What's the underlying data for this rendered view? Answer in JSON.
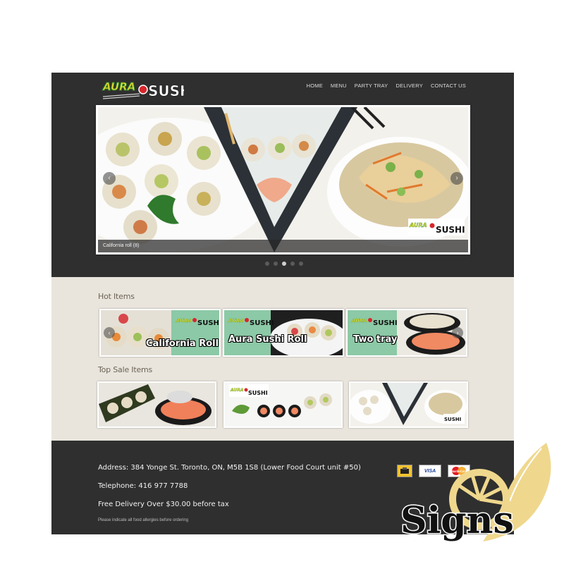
{
  "brand": {
    "logo_word_1": "AURA",
    "logo_word_2": "SUSHI"
  },
  "nav": {
    "items": [
      {
        "label": "HOME"
      },
      {
        "label": "MENU"
      },
      {
        "label": "PARTY TRAY"
      },
      {
        "label": "DELIVERY"
      },
      {
        "label": "CONTACT US"
      }
    ]
  },
  "slider": {
    "caption": "California roll (8)",
    "prev_icon": "chevron-left-icon",
    "next_icon": "chevron-right-icon",
    "slide_count": 5,
    "active_slide": 3
  },
  "hot_items": {
    "title": "Hot Items",
    "tiles": [
      {
        "label": "California Roll"
      },
      {
        "label": "Aura Sushi Roll"
      },
      {
        "label": "Two tray"
      }
    ]
  },
  "top_sale": {
    "title": "Top Sale Items"
  },
  "footer": {
    "address": "Address:  384 Yonge St. Toronto, ON, M5B 1S8 (Lower Food Court unit #50)",
    "telephone": "Telephone:  416 977 7788",
    "delivery": "Free Delivery Over $30.00 before tax",
    "note": "Please indicate all food allergies before ordering",
    "payments": [
      "VISA",
      "MasterCard"
    ]
  },
  "watermark": {
    "text": "Signs"
  },
  "colors": {
    "header_bg": "#2f2f2f",
    "body_bg": "#e9e5dd",
    "accent_green": "#8cc9a6",
    "logo_yellow": "#f2e233",
    "watermark_gold": "#efd78d"
  }
}
